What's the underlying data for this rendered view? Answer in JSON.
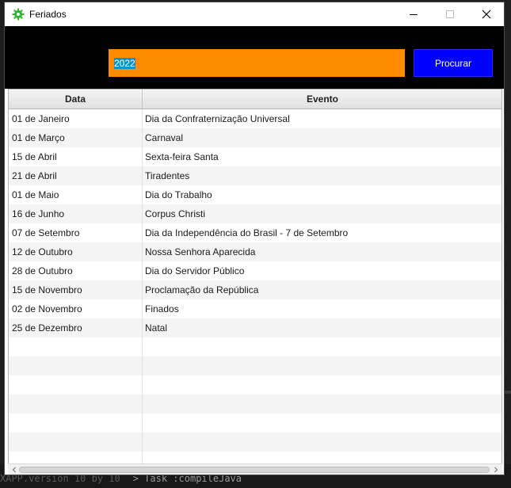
{
  "window": {
    "title": "Feriados"
  },
  "search": {
    "value": "2022",
    "button_label": "Procurar"
  },
  "table": {
    "columns": [
      "Data",
      "Evento"
    ],
    "rows": [
      {
        "date": "01 de Janeiro",
        "event": "Dia da Confraternização Universal"
      },
      {
        "date": "01 de Março",
        "event": "Carnaval"
      },
      {
        "date": "15 de Abril",
        "event": "Sexta-feira Santa"
      },
      {
        "date": "21 de Abril",
        "event": "Tiradentes"
      },
      {
        "date": "01 de Maio",
        "event": "Dia do Trabalho"
      },
      {
        "date": "16 de Junho",
        "event": "Corpus Christi"
      },
      {
        "date": "07 de Setembro",
        "event": "Dia da Independência do Brasil - 7 de Setembro"
      },
      {
        "date": "12 de Outubro",
        "event": "Nossa Senhora Aparecida"
      },
      {
        "date": "28 de Outubro",
        "event": "Dia do Servidor Público"
      },
      {
        "date": "15 de Novembro",
        "event": "Proclamação da República"
      },
      {
        "date": "02 de Novembro",
        "event": "Finados"
      },
      {
        "date": "25 de Dezembro",
        "event": "Natal"
      }
    ],
    "empty_rows": 7
  },
  "background": {
    "status_text": "> Task :compileJava",
    "muted_text": "XAPP.version 10 by 10"
  },
  "colors": {
    "toolbar": "#000000",
    "input": "#ff8c00",
    "button": "#0000ff",
    "selection": "#0096c9"
  }
}
